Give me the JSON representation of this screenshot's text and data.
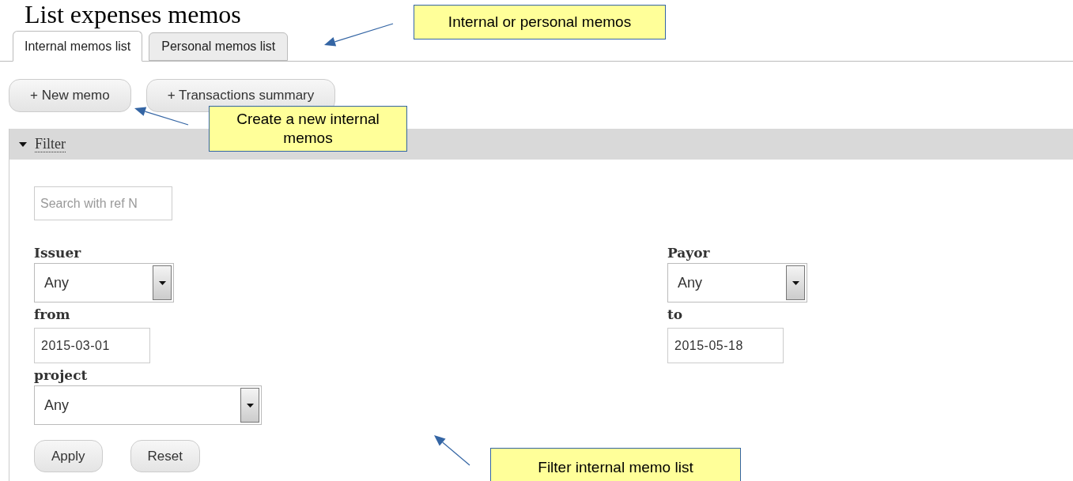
{
  "page_title": "List expenses memos",
  "tabs": [
    {
      "label": "Internal memos list",
      "selected": true
    },
    {
      "label": "Personal memos list",
      "selected": false
    }
  ],
  "actions": [
    "+ New memo",
    "+ Transactions summary"
  ],
  "filter": {
    "title": "Filter",
    "expanded": true,
    "search": {
      "placeholder": "Search with ref N"
    },
    "fields": [
      {
        "kind": "select",
        "label": "Issuer",
        "value": "Any"
      },
      {
        "kind": "select",
        "label": "Payor",
        "value": "Any"
      },
      {
        "kind": "date",
        "label": "from",
        "value": "2015-03-01"
      },
      {
        "kind": "date",
        "label": "to",
        "value": "2015-05-18"
      },
      {
        "kind": "select",
        "label": "project",
        "value": "Any"
      }
    ],
    "buttons": [
      "Apply",
      "Reset"
    ]
  },
  "callouts": [
    "Internal or personal memos",
    "Create a new internal memos",
    "Filter internal memo list"
  ]
}
